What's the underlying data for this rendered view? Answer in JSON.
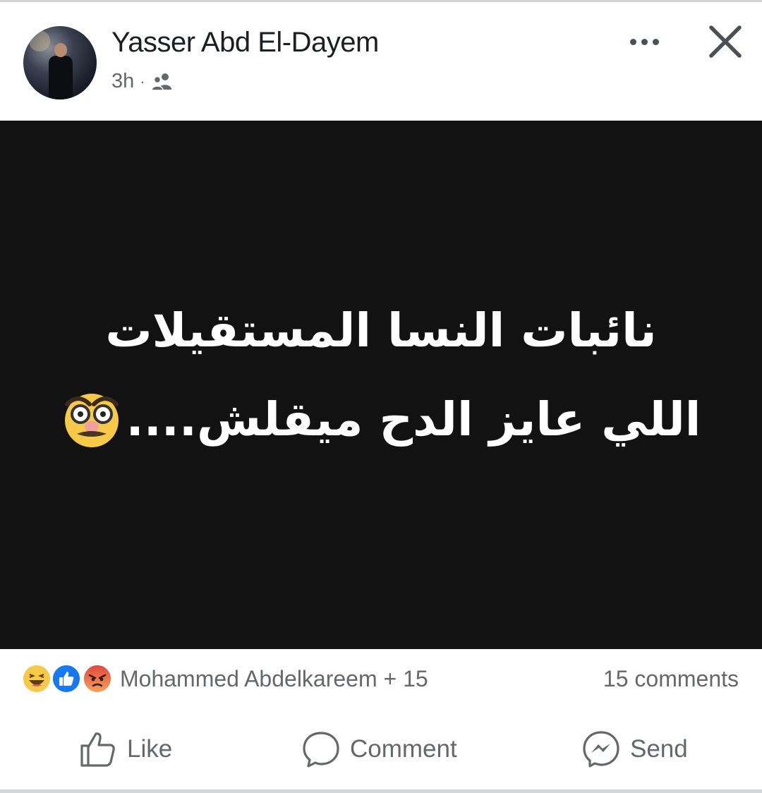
{
  "post": {
    "author": "Yasser Abd El-Dayem",
    "time": "3h",
    "separator": "·",
    "audience_icon": "friends-icon",
    "image_text": {
      "line1": "نائبات النسا المستقيلات",
      "line2": "اللي عايز الدح ميقلش....",
      "emoji_icon": "disguised-face-icon"
    }
  },
  "reactions": {
    "icons": [
      "haha-reaction-icon",
      "like-reaction-icon",
      "angry-reaction-icon"
    ],
    "summary": "Mohammed Abdelkareem + 15",
    "comments": "15 comments"
  },
  "actions": {
    "like": "Like",
    "comment": "Comment",
    "send": "Send"
  },
  "colors": {
    "text_primary": "#1c1e21",
    "text_secondary": "#65676b",
    "image_bg": "#121212",
    "like_blue": "#1877f2"
  }
}
